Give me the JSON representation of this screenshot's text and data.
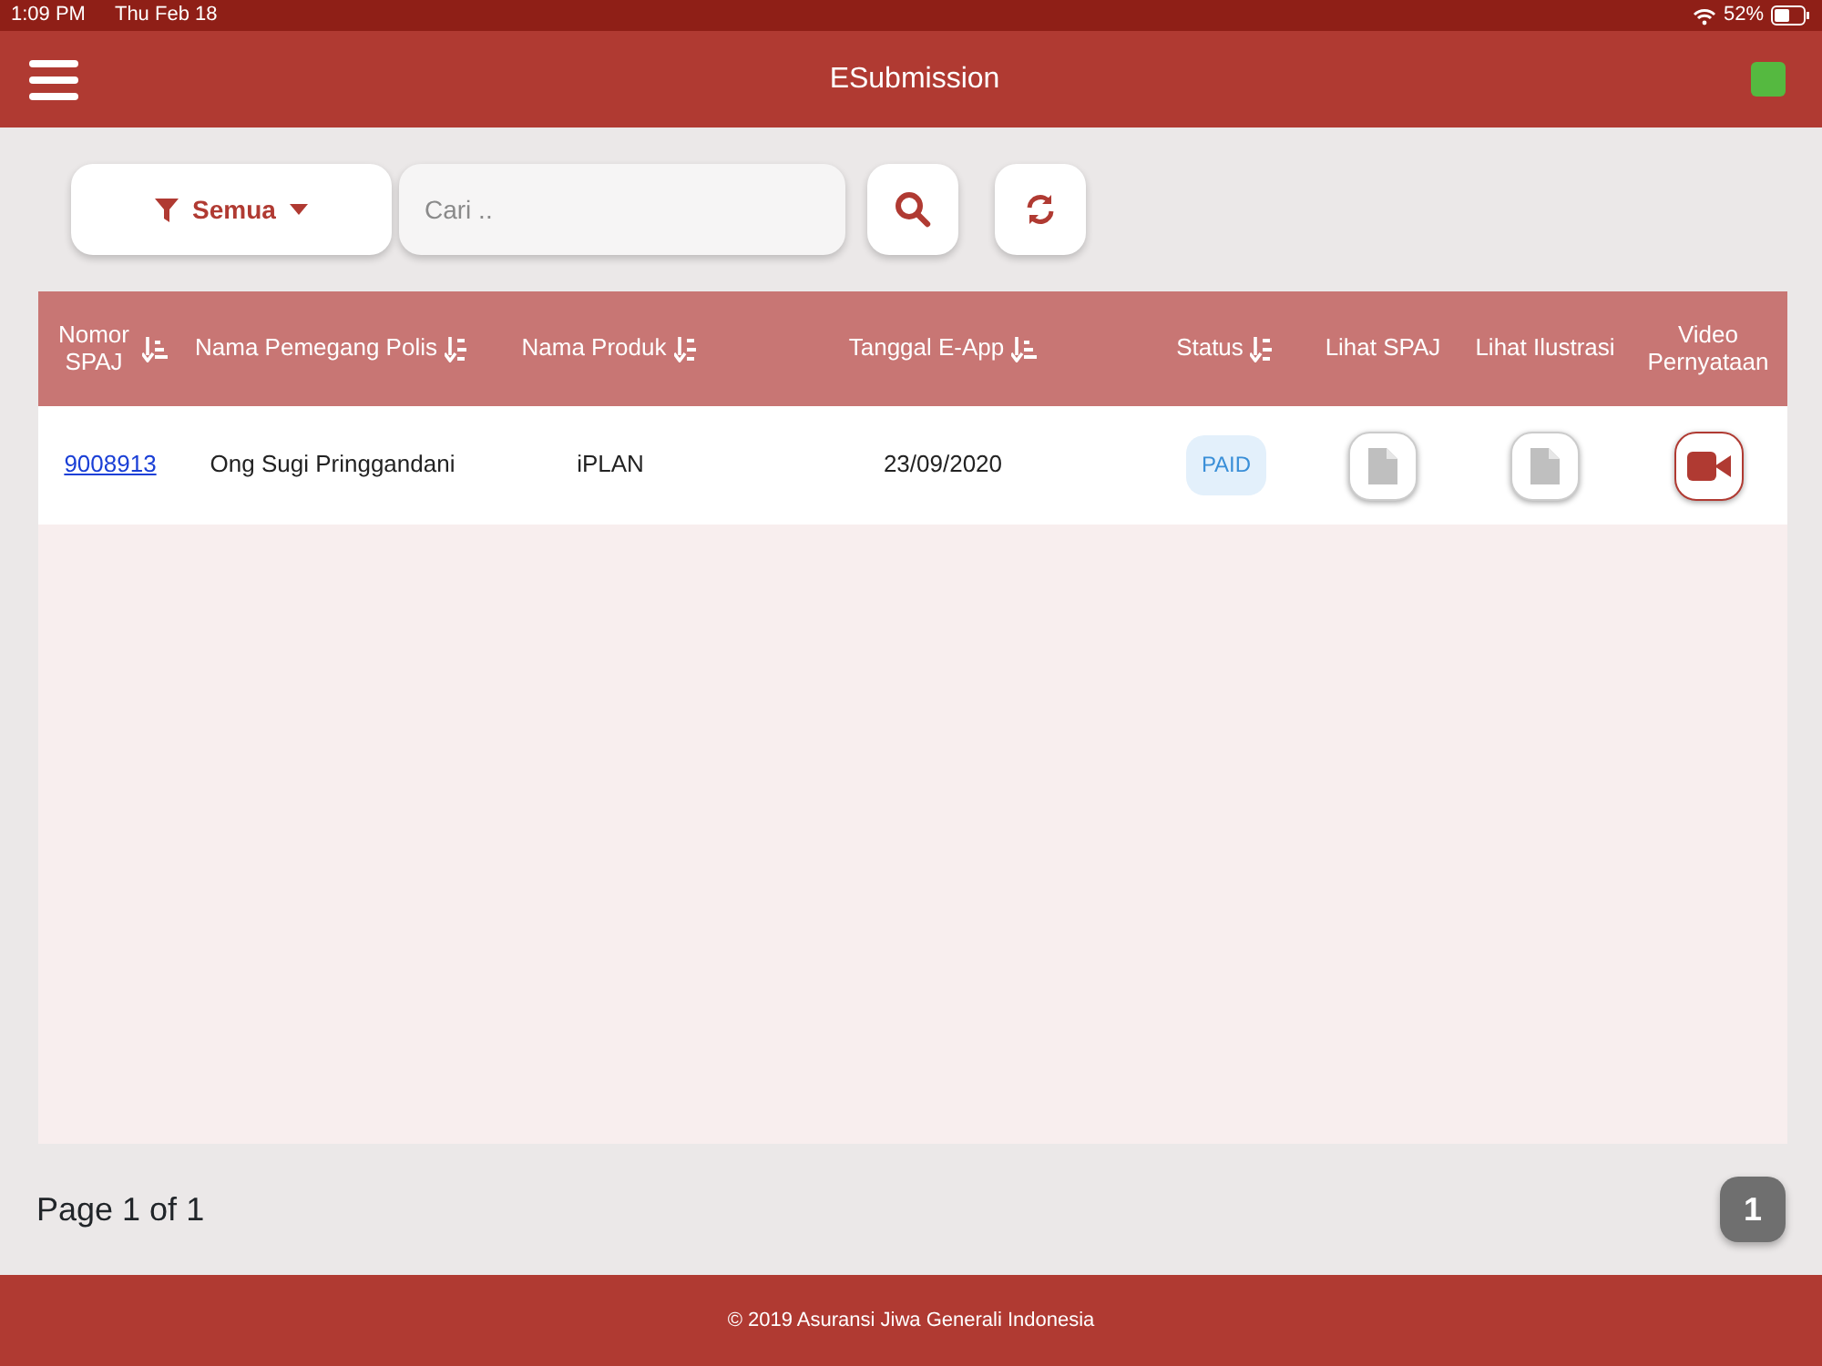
{
  "status_bar": {
    "time": "1:09 PM",
    "date": "Thu Feb 18",
    "battery": "52%"
  },
  "window": {
    "title": "ESubmission"
  },
  "toolbar": {
    "filter": "Semua",
    "search": {
      "placeholder": "Cari .."
    }
  },
  "table": {
    "columns": [
      {
        "label": "Nomor SPAJ",
        "kind": "amount"
      },
      {
        "label": "Nama Pemegang Polis",
        "kind": "alpha"
      },
      {
        "label": "Nama Produk",
        "kind": "alpha"
      },
      {
        "label": "Tanggal E-App",
        "kind": "amount"
      },
      {
        "label": "Status",
        "kind": "alpha"
      },
      {
        "label": "Lihat SPAJ",
        "kind": "plain"
      },
      {
        "label": "Lihat Ilustrasi",
        "kind": "plain"
      },
      {
        "label": "Video Pernyataan",
        "kind": "plain"
      }
    ],
    "rows": [
      {
        "spaj": "9008913",
        "holder": "Ong Sugi Pringgandani",
        "product": "iPLAN",
        "date": "23/09/2020",
        "status": "PAID"
      }
    ]
  },
  "pagination": {
    "label": "Page 1 of 1",
    "pages": [
      {
        "label": "1",
        "selected": true
      }
    ]
  },
  "footer": "© 2019 Asuransi Jiwa Generali Indonesia"
}
